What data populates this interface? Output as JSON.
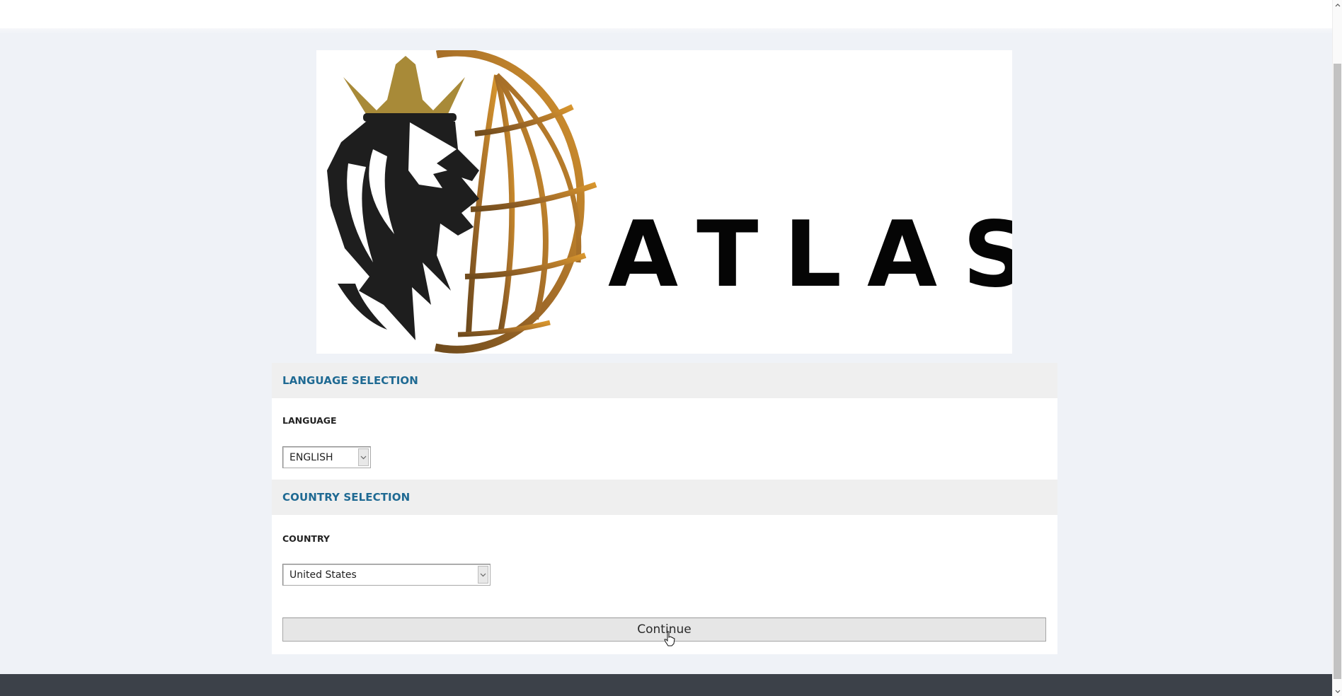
{
  "brand": {
    "logo_text": "ATLAS",
    "logo_icon": "lion-crown-globe-logo",
    "colors": {
      "gold": "#b8862c",
      "crown": "#a88a38",
      "dark": "#1e1e1e"
    }
  },
  "language_section": {
    "title": "LANGUAGE SELECTION",
    "field_label": "LANGUAGE",
    "selected": "ENGLISH"
  },
  "country_section": {
    "title": "COUNTRY SELECTION",
    "field_label": "COUNTRY",
    "selected": "United States"
  },
  "actions": {
    "continue_label": "Continue"
  },
  "theme": {
    "section_title_color": "#1f6a93",
    "page_background": "#eff2f7",
    "footer_color": "#3c4149"
  }
}
